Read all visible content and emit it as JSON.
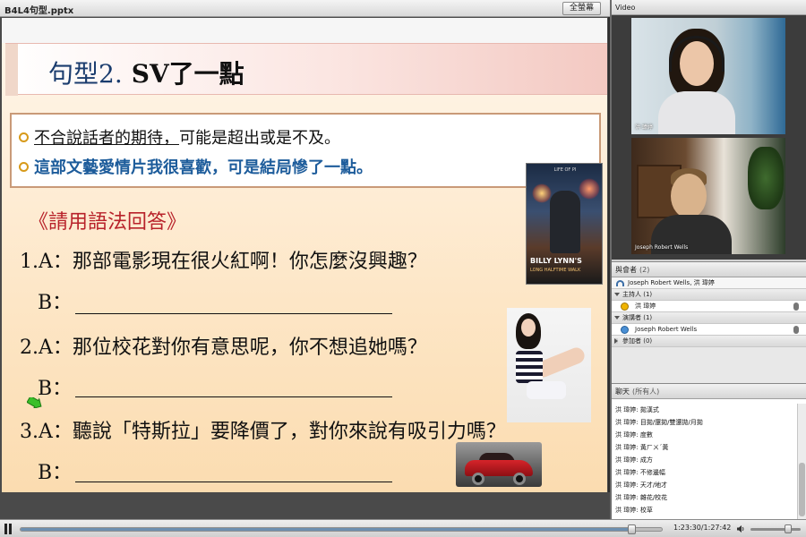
{
  "slide_pane": {
    "file_name": "B4L4句型.pptx",
    "fullscreen_label": "全螢幕"
  },
  "slide": {
    "title_prefix": "句型2.",
    "title_main": "SV了一點",
    "bullets": [
      {
        "underlined": "不合說話者的期待，",
        "rest": "可能是超出或是不及。"
      },
      {
        "text": "這部文藝愛情片我很喜歡，可是結局慘了一點。"
      }
    ],
    "poster": {
      "top_text": "LIFE OF PI",
      "title": "BILLY LYNN'S",
      "subtitle": "LONG HALFTIME WALK"
    },
    "prompt": "《請用語法回答》",
    "questions": [
      {
        "q": "1.A：那部電影現在很火紅啊！你怎麼沒興趣？",
        "a": "B："
      },
      {
        "q": "2.A：那位校花對你有意思呢，你不想追她嗎？",
        "a": "B："
      },
      {
        "q": "3.A：聽說「特斯拉」要降價了，對你來說有吸引力嗎？",
        "a": "B："
      }
    ]
  },
  "video": {
    "title": "Video",
    "cameras": [
      {
        "label": "洪 瑋婷"
      },
      {
        "label": "Joseph Robert Wells"
      }
    ]
  },
  "attendees": {
    "title": "與會者",
    "count": "(2)",
    "connected_line": "Joseph Robert Wells, 洪 瑋婷",
    "groups": [
      {
        "label": "主持人 (1)",
        "members": [
          "洪 瑋婷"
        ]
      },
      {
        "label": "演講者 (1)",
        "members": [
          "Joseph Robert Wells"
        ]
      },
      {
        "label": "參加者 (0)",
        "members": []
      }
    ]
  },
  "chat": {
    "title": "聊天",
    "scope": "(所有人)",
    "messages": [
      {
        "who": "洪 瑋婷:",
        "text": "拋漢式"
      },
      {
        "who": "洪 瑋婷:",
        "text": "目拋/還拋/雙還拋/月拋"
      },
      {
        "who": "洪 瑋婷:",
        "text": "度數"
      },
      {
        "who": "洪 瑋婷:",
        "text": "黃ㄏㄨˊ黃"
      },
      {
        "who": "洪 瑋婷:",
        "text": "成方"
      },
      {
        "who": "洪 瑋婷:",
        "text": "不修邊幅"
      },
      {
        "who": "洪 瑋婷:",
        "text": "天才/地才"
      },
      {
        "who": "洪 瑋婷:",
        "text": "雜花/校花"
      },
      {
        "who": "洪 瑋婷:",
        "text": "校草"
      }
    ]
  },
  "playback": {
    "time": "1:23:30/1:27:42",
    "progress": 0.952,
    "volume": 0.75
  }
}
